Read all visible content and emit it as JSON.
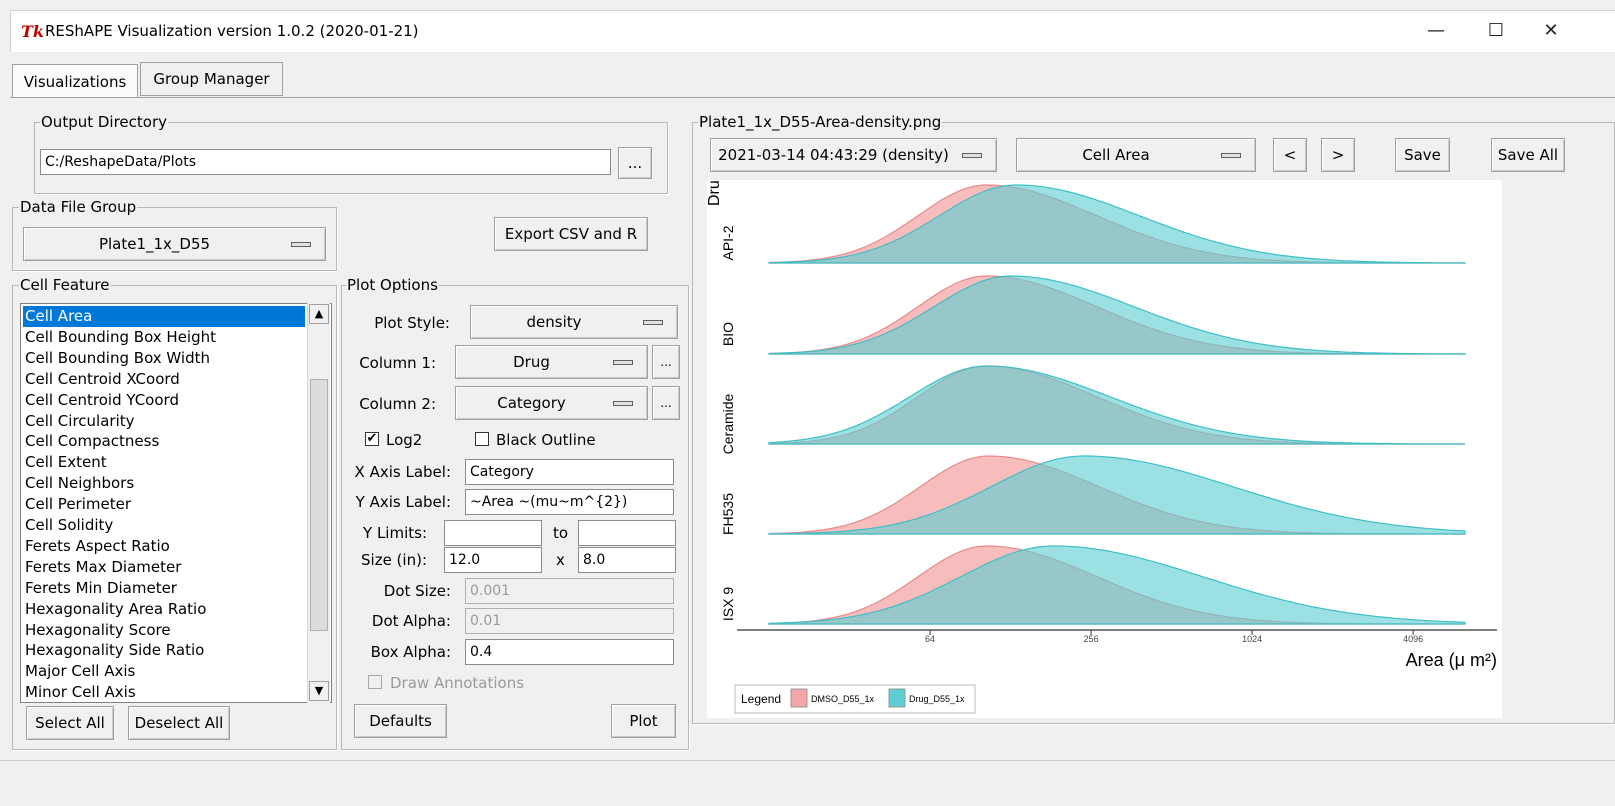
{
  "window": {
    "icon": "Tk",
    "title": "REShAPE Visualization version 1.0.2 (2020-01-21)",
    "minimize": "—",
    "maximize": "☐",
    "close": "✕"
  },
  "tabs": [
    "Visualizations",
    "Group Manager"
  ],
  "output_directory": {
    "label": "Output Directory",
    "value": "C:/ReshapeData/Plots",
    "browse": "..."
  },
  "data_file_group": {
    "label": "Data File Group",
    "value": "Plate1_1x_D55"
  },
  "export_button": "Export CSV and R",
  "cell_feature": {
    "label": "Cell Feature",
    "items": [
      "Cell Area",
      "Cell Bounding Box Height",
      "Cell Bounding Box Width",
      "Cell Centroid XCoord",
      "Cell Centroid YCoord",
      "Cell Circularity",
      "Cell Compactness",
      "Cell Extent",
      "Cell Neighbors",
      "Cell Perimeter",
      "Cell Solidity",
      "Ferets Aspect Ratio",
      "Ferets Max Diameter",
      "Ferets Min Diameter",
      "Hexagonality Area Ratio",
      "Hexagonality Score",
      "Hexagonality Side Ratio",
      "Major Cell Axis",
      "Minor Cell Axis"
    ],
    "selected_index": 0,
    "select_all": "Select All",
    "deselect_all": "Deselect All"
  },
  "plot_options": {
    "label": "Plot Options",
    "plot_style_label": "Plot Style:",
    "plot_style": "density",
    "column1_label": "Column 1:",
    "column1": "Drug",
    "column2_label": "Column 2:",
    "column2": "Category",
    "ellipsis": "...",
    "log2_label": "Log2",
    "log2_checked": "✔",
    "black_outline_label": "Black Outline",
    "x_axis_label_label": "X Axis Label:",
    "x_axis_label": "Category",
    "y_axis_label_label": "Y Axis Label:",
    "y_axis_label": "~Area ~(mu~m^{2})",
    "y_limits_label": "Y Limits:",
    "to_label": "to",
    "size_label": "Size (in):",
    "size_w": "12.0",
    "x_label": "x",
    "size_h": "8.0",
    "dot_size_label": "Dot Size:",
    "dot_size": "0.001",
    "dot_alpha_label": "Dot Alpha:",
    "dot_alpha": "0.01",
    "box_alpha_label": "Box Alpha:",
    "box_alpha": "0.4",
    "draw_annotations": "Draw Annotations",
    "defaults": "Defaults",
    "plot": "Plot"
  },
  "plot_panel": {
    "label": "Plate1_1x_D55-Area-density.png",
    "timestamp_select": "2021-03-14 04:43:29 (density)",
    "feature_select": "Cell Area",
    "prev": "<",
    "next": ">",
    "save": "Save",
    "save_all": "Save All"
  },
  "chart_data": {
    "type": "area",
    "subtype": "ridgeline density",
    "facet_label": "Drug",
    "xlabel": "Area (μ m²)",
    "x_scale": "log2",
    "x_ticks": [
      64,
      256,
      1024,
      4096
    ],
    "facets": [
      "API-2",
      "BIO",
      "Ceramide",
      "FH535",
      "ISX 9"
    ],
    "series": [
      {
        "name": "DMSO_D55_1x",
        "color": "#f4a6a6",
        "mode_x": [
          104,
          104,
          104,
          106,
          104
        ]
      },
      {
        "name": "Drug_D55_1x",
        "color": "#5dcfd4",
        "mode_x": [
          134,
          128,
          104,
          240,
          185
        ]
      }
    ],
    "legend": {
      "title": "Legend",
      "position": "bottom-left"
    }
  }
}
